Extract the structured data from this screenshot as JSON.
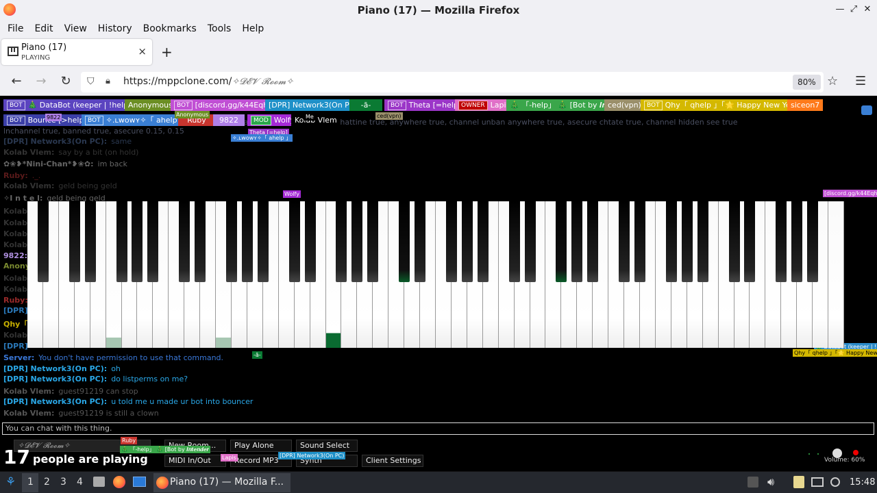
{
  "window": {
    "title": "Piano (17) — Mozilla Firefox"
  },
  "menu": [
    "File",
    "Edit",
    "View",
    "History",
    "Bookmarks",
    "Tools",
    "Help"
  ],
  "tab": {
    "title": "Piano (17)",
    "subtitle": "PLAYING",
    "close": "×",
    "new_tab": "+"
  },
  "nav": {
    "url_host": "https://mppclone.com/",
    "url_path": "✧𝓓𝓔𝓥 𝓡𝓸𝓸𝓶✧",
    "zoom": "80%"
  },
  "ghost": {
    "line1": "kolab Vlem: chatWith true, chattine true, anywhere true, channel unban anywhere true, asecure chtate true, channel hidden see true",
    "line2": "lnchannel true, banned true, asecure 0.15, 0.15"
  },
  "users": [
    {
      "text": "BOT",
      "badge": true,
      "label": "🎄 DataBot (keeper | !help) 🎄",
      "color": "#5b44c0"
    },
    {
      "label": "Anonymous",
      "color": "#6b8e23"
    },
    {
      "text": "BOT",
      "badge": true,
      "label": "[discord.gg/k44Eqha]",
      "color": "#c04fd4"
    },
    {
      "label": "[DPR] Network3(On PC)",
      "color": "#1e90c8"
    },
    {
      "label": "-ā-",
      "color": "#0a7a33"
    },
    {
      "text": "BOT",
      "badge": true,
      "label": "Theta [=help]",
      "color": "#9b36c8"
    },
    {
      "text": "OWNER",
      "badge": true,
      "label": "Lapis",
      "color": "#e070c8"
    },
    {
      "label": "🎄 「-help」 🎄 [Bot by 𝑰𝒏𝒕𝒆𝒏𝒅𝒆𝒓",
      "color": "#3aa64a"
    },
    {
      "label": "ced(vpn)",
      "color": "#9a8f6a"
    },
    {
      "text": "BOT",
      "badge": true,
      "label": "Qhy「 qhelp 」「🌟 Happy New Year 」",
      "color": "#d4b800"
    },
    {
      "label": "siceon7",
      "color": "#ff7a1a"
    },
    {
      "text": "BOT",
      "badge": true,
      "label": "Bounce [>help]",
      "color": "#3b3fa8"
    },
    {
      "text": "BOT",
      "badge": true,
      "label": "✧.ʟᴡᴏᴡʏ✧「 ahelp 」",
      "color": "#3a7fd4"
    },
    {
      "label": "Ruby",
      "color": "#c8352e"
    },
    {
      "label": "9822",
      "color": "#b080e8"
    },
    {
      "text": "MOD",
      "badge": true,
      "label": "Wolfy",
      "color": "#a52ad6"
    },
    {
      "label": "Kolab Vlem",
      "color": "#000000"
    }
  ],
  "tiny": {
    "n9822": "9822",
    "anonymous": "Anonymous",
    "me": "Me",
    "cedvpn": "ced(vpn)",
    "theta": "Theta [=help]",
    "wowy": "✧.ʟᴡᴏᴡʏ✧「 ahelp 」",
    "wolfy": "Wolfy",
    "discord": "[discord.gg/k44Eqha]",
    "a": "-ā-",
    "databot": "🎄 DataBot (keeper | !h",
    "qhy": "Qhy「 qhelp 」「🌟 Happy New",
    "ruby": "Ruby",
    "help": "🎄 「-help」 🎄 [Bot by 𝑰𝒏𝒕𝒆𝒏𝒅𝒆𝒓",
    "lapis": "Lapis",
    "network": "[DPR] Network3(On PC)"
  },
  "chat_faded": [
    {
      "who": "[DPR] Network3(On PC):",
      "msg": "same"
    },
    {
      "who": "Kolab Vlem:",
      "msg": "say by a bit (on hold)"
    },
    {
      "who": "✿❀❥*Nini-Chan*❥❀✿:",
      "msg": "im back"
    },
    {
      "who": "Ruby:",
      "msg": "._."
    },
    {
      "who": "Kolab Vlem:",
      "msg": "geld being geld"
    },
    {
      "who": "✧I n t e l:",
      "msg": "geld being geld"
    }
  ],
  "side_names": [
    "Kolab",
    "Kolab",
    "Kolab",
    "Kolab",
    "9822:",
    "Anony",
    "Kolab",
    "Kolab",
    "Ruby:",
    "[DPR]",
    "Qhy「",
    "Kolab",
    "[DPR]"
  ],
  "chat": [
    {
      "who": "Server:",
      "msg": "You don't have permission to use that command.",
      "color": "#3a78d8",
      "fade": false
    },
    {
      "who": "[DPR] Network3(On PC):",
      "msg": "oh",
      "color": "#2aa8e8",
      "fade": false
    },
    {
      "who": "[DPR] Network3(On PC):",
      "msg": "do listperms on me?",
      "color": "#2aa8e8",
      "fade": false
    },
    {
      "who": "Kolab Vlem:",
      "msg": "guest91219 can stop",
      "color": "#777777",
      "fade": true
    },
    {
      "who": "[DPR] Network3(On PC):",
      "msg": "u told me u made ur bot into bouncer",
      "color": "#2aa8e8",
      "fade": false
    },
    {
      "who": "Kolab Vlem:",
      "msg": "guest91219 is still a clown",
      "color": "#777777",
      "fade": true
    }
  ],
  "chat_placeholder": "You can chat with this thing.",
  "controls": {
    "room": "✧𝓓𝓔𝓥 𝓡𝓸𝓸𝓶✧",
    "new_room": "New Room...",
    "play_alone": "Play Alone",
    "sound_select": "Sound Select",
    "midi": "MIDI In/Out",
    "record": "Record MP3",
    "synth": "Synth",
    "client_settings": "Client Settings",
    "count": "17",
    "count_label": "people are playing",
    "volume": "Volume: 60%"
  },
  "taskbar": {
    "workspaces": [
      "1",
      "2",
      "3",
      "4"
    ],
    "task_label": "Piano (17) — Mozilla F...",
    "clock": "15:48"
  }
}
